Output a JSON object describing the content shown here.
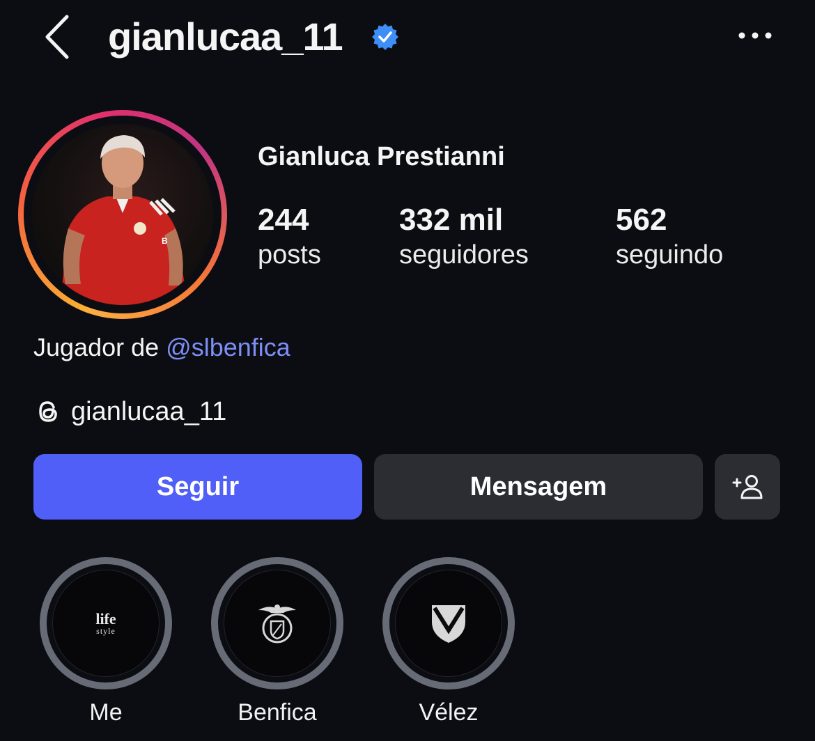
{
  "header": {
    "username": "gianlucaa_11",
    "verified": true,
    "back_icon": "chevron-left-icon",
    "more_icon": "more-horizontal-icon"
  },
  "profile": {
    "full_name": "Gianluca Prestianni",
    "stats": [
      {
        "value": "244",
        "label": "posts"
      },
      {
        "value": "332 mil",
        "label": "seguidores"
      },
      {
        "value": "562",
        "label": "seguindo"
      }
    ],
    "bio_prefix": "Jugador de ",
    "bio_mention": "@slbenfica",
    "threads_handle": "gianlucaa_11"
  },
  "actions": {
    "follow_label": "Seguir",
    "message_label": "Mensagem",
    "suggest_icon": "add-person-icon"
  },
  "highlights": [
    {
      "name": "Me",
      "cover_text_1": "life",
      "cover_text_2": "style"
    },
    {
      "name": "Benfica"
    },
    {
      "name": "Vélez"
    }
  ],
  "colors": {
    "background": "#0c0d12",
    "follow_button": "#4f5ff7",
    "secondary_button": "#2b2d33",
    "mention": "#7d8ff5",
    "verified_badge": "#3d8ef7"
  }
}
